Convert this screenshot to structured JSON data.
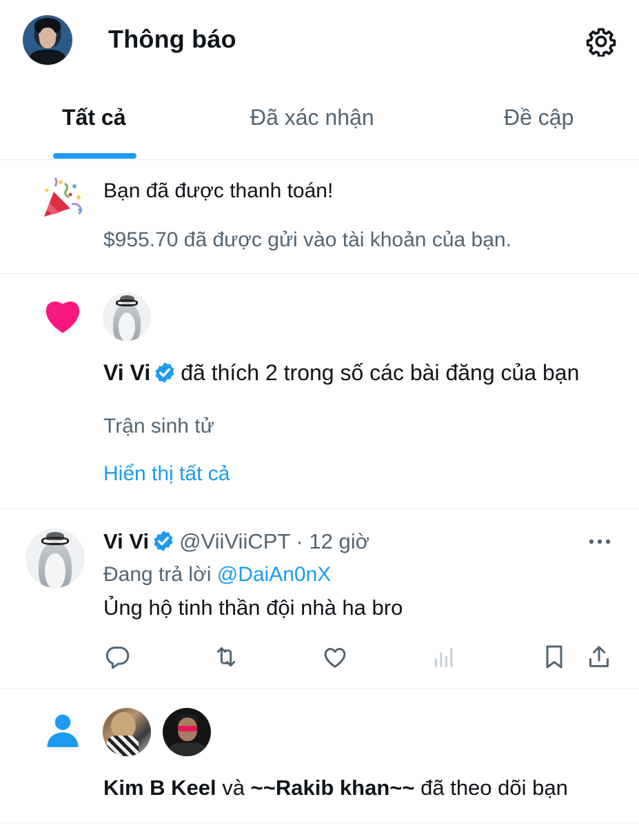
{
  "header": {
    "title": "Thông báo"
  },
  "tabs": [
    {
      "label": "Tất cả",
      "active": true
    },
    {
      "label": "Đã xác nhận",
      "active": false
    },
    {
      "label": "Đề cập",
      "active": false
    }
  ],
  "notifications": {
    "payment": {
      "icon": "party-popper-icon",
      "title": "Bạn đã được thanh toán!",
      "subtitle": "$955.70 đã được gửi vào tài khoản của bạn."
    },
    "like": {
      "icon": "heart-icon",
      "user_name": "Vi Vi",
      "action_text": "đã thích 2 trong số các bài đăng của bạn",
      "post_title": "Trận sinh tử",
      "show_all_label": "Hiển thị tất cả"
    },
    "reply": {
      "user_name": "Vi Vi",
      "handle": "@ViiViiCPT",
      "separator": "·",
      "time": "12 giờ",
      "replying_prefix": "Đang trả lời",
      "replying_to": "@DaiAn0nX",
      "text": "Ủng hộ tinh thần đội nhà ha bro",
      "actions": [
        "reply-icon",
        "retweet-icon",
        "like-icon",
        "views-icon",
        "bookmark-icon",
        "share-icon"
      ]
    },
    "follow": {
      "icon": "person-icon",
      "user1": "Kim B Keel",
      "conjunction": "và",
      "user2": "~~Rakib khan~~",
      "action_text": "đã theo dõi bạn"
    }
  },
  "colors": {
    "accent": "#1d9bf0",
    "heart": "#f91880",
    "secondary_text": "#536471",
    "primary_text": "#0f1419"
  }
}
